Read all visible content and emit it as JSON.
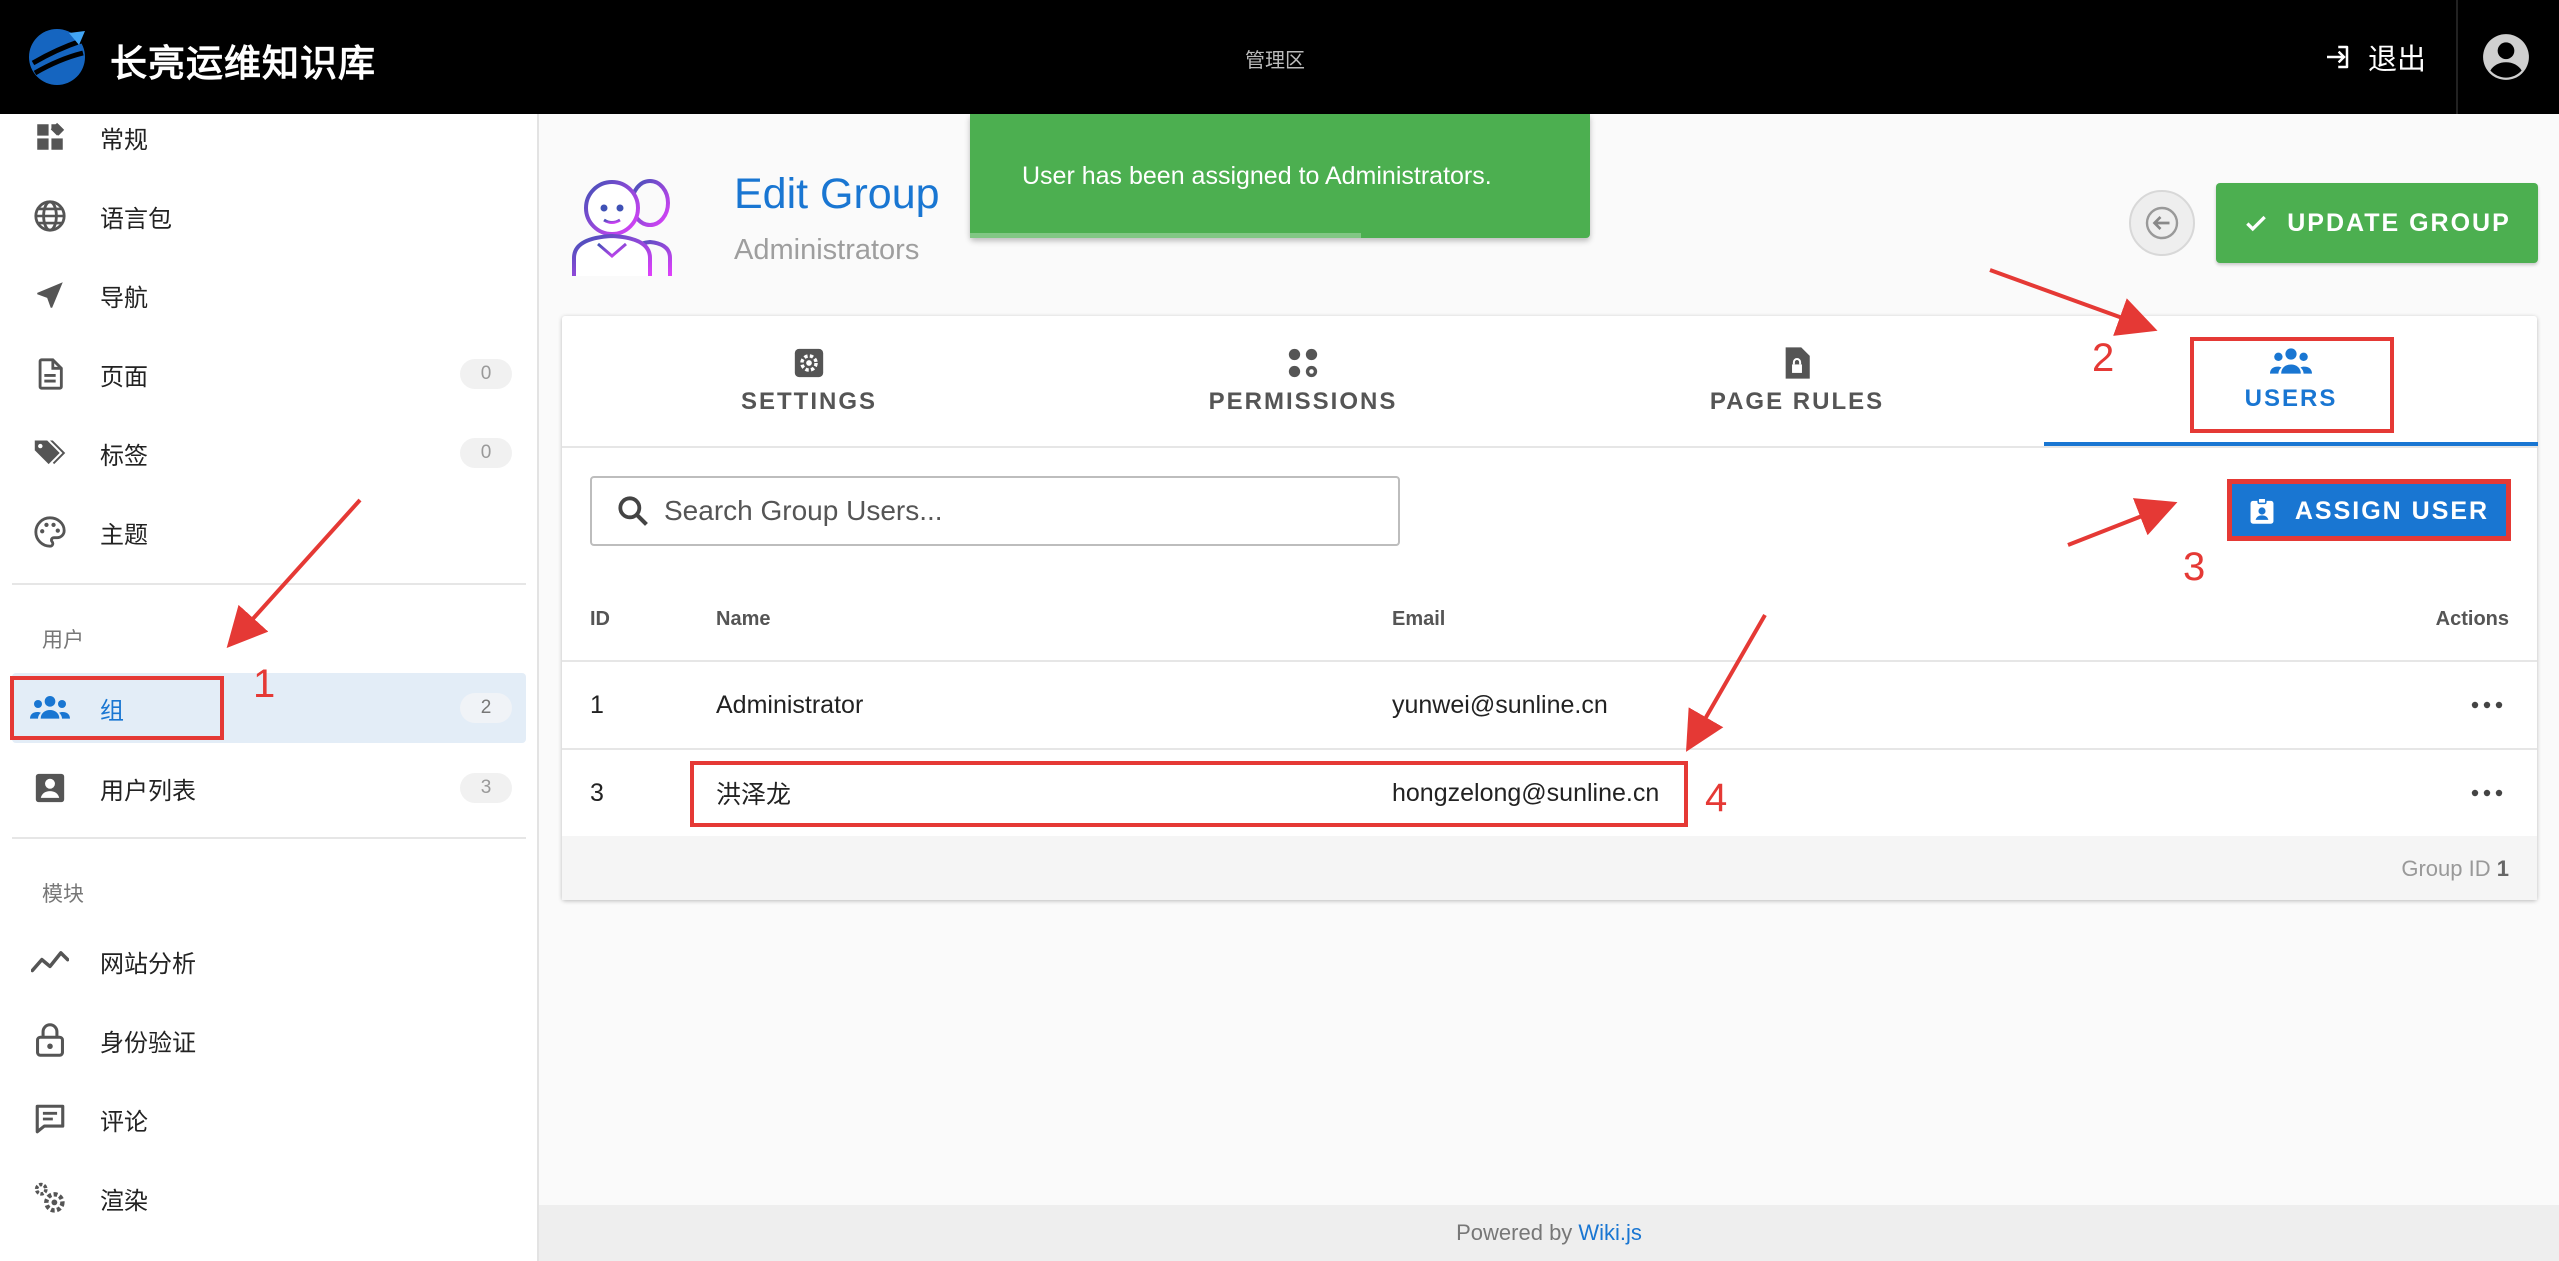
{
  "topbar": {
    "app_title": "长亮运维知识库",
    "admin_area": "管理区",
    "logout_label": "退出"
  },
  "sidebar": {
    "items": [
      {
        "label": "常规",
        "icon": "dashboard-icon"
      },
      {
        "label": "语言包",
        "icon": "globe-icon"
      },
      {
        "label": "导航",
        "icon": "navigation-arrow-icon"
      },
      {
        "label": "页面",
        "icon": "page-icon",
        "count": "0"
      },
      {
        "label": "标签",
        "icon": "tags-icon",
        "count": "0"
      },
      {
        "label": "主题",
        "icon": "palette-icon"
      }
    ],
    "users_section": "用户",
    "users_items": [
      {
        "label": "组",
        "icon": "group-icon",
        "count": "2",
        "active": true
      },
      {
        "label": "用户列表",
        "icon": "user-card-icon",
        "count": "3"
      }
    ],
    "modules_section": "模块",
    "module_items": [
      {
        "label": "网站分析",
        "icon": "analytics-icon"
      },
      {
        "label": "身份验证",
        "icon": "lock-icon"
      },
      {
        "label": "评论",
        "icon": "comment-icon"
      },
      {
        "label": "渲染",
        "icon": "gears-icon"
      }
    ]
  },
  "header": {
    "title": "Edit Group",
    "subtitle": "Administrators",
    "update_label": "UPDATE GROUP"
  },
  "toast": {
    "message": "User has been assigned to Administrators.",
    "progress": 0.63
  },
  "tabs": [
    {
      "label": "SETTINGS",
      "icon": "gear-icon"
    },
    {
      "label": "PERMISSIONS",
      "icon": "permissions-icon"
    },
    {
      "label": "PAGE RULES",
      "icon": "page-lock-icon"
    },
    {
      "label": "USERS",
      "icon": "users-icon",
      "active": true
    }
  ],
  "users_panel": {
    "search_placeholder": "Search Group Users...",
    "assign_label": "ASSIGN USER",
    "columns": [
      "ID",
      "Name",
      "Email",
      "Actions"
    ],
    "rows": [
      {
        "id": "1",
        "name": "Administrator",
        "email": "yunwei@sunline.cn"
      },
      {
        "id": "3",
        "name": "洪泽龙",
        "email": "hongzelong@sunline.cn"
      }
    ],
    "footer_label": "Group ID",
    "footer_value": "1"
  },
  "footer": {
    "powered_by": "Powered by",
    "link": "Wiki.js"
  },
  "annotations": [
    "1",
    "2",
    "3",
    "4"
  ],
  "colors": {
    "primary": "#1976d2",
    "success": "#4caf50",
    "annotation": "#e53935",
    "topbar": "#000000"
  }
}
